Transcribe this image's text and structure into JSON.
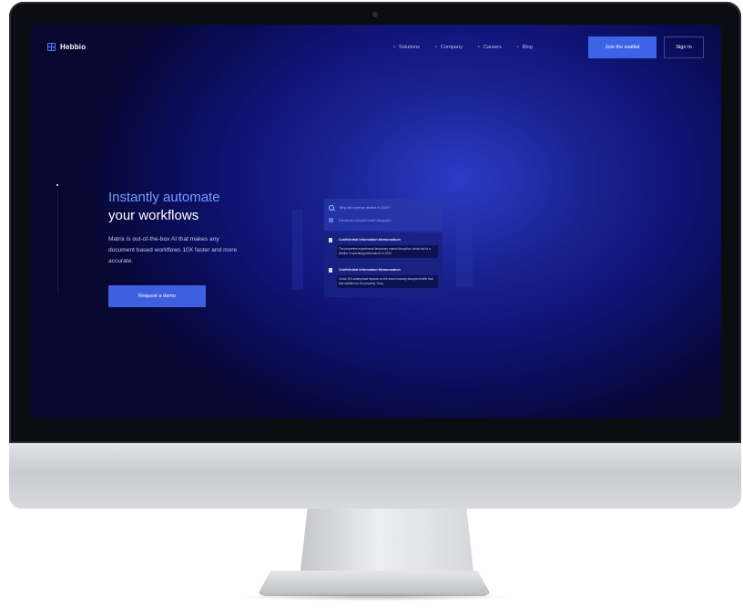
{
  "nav": {
    "logo_text": "Hebbio",
    "links": [
      "Solutions",
      "Company",
      "Careers",
      "Blog"
    ],
    "waitlist_label": "Join the waitlist",
    "signin_label": "Sign In"
  },
  "hero": {
    "title_accent": "Instantly automate",
    "title_rest": "your workflows",
    "subtitle": "Matrix is out-of-the-box AI that makes any document based workflows 10X faster and more accurate.",
    "cta_label": "Request a demo"
  },
  "panel": {
    "search_query": "Why did revenue decline in 2020?",
    "tag_label": "Pandemic induced travel disruption",
    "results": [
      {
        "title": "Confidential Information Memorandum",
        "snippet": "The properties experienced temporary market disruption, which led to a decline in operating performance in 2020."
      },
      {
        "title": "Confidential Information Memorandum",
        "snippet": "Covid-19's widespread impacts on the travel industry disrupted traffic flow and visitation to the property. Occu."
      }
    ]
  },
  "colors": {
    "accent": "#3d63e6",
    "title_accent": "#6fa0ff",
    "background_center": "#2c3bc6",
    "background_edge": "#07072f"
  }
}
